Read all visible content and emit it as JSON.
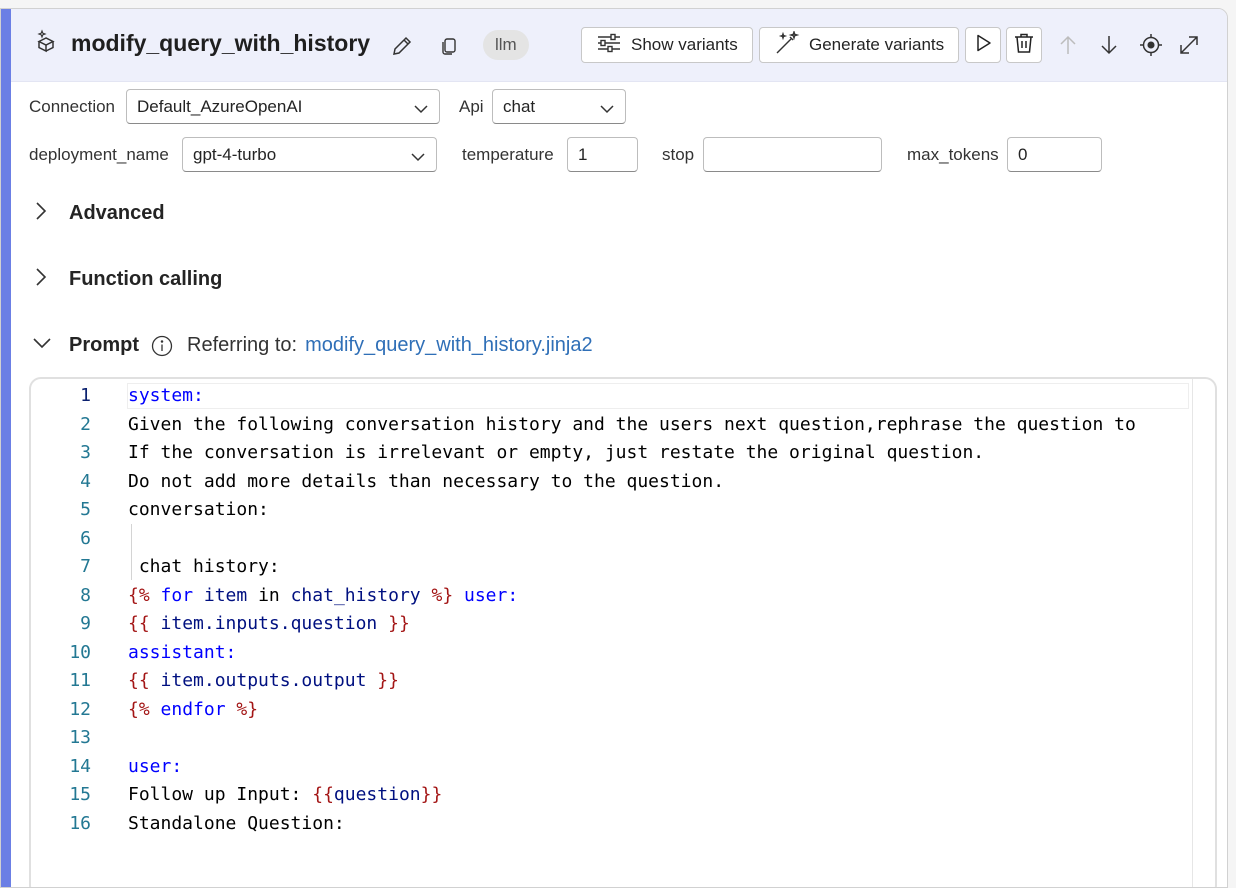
{
  "node": {
    "title": "modify_query_with_history",
    "type_badge": "llm"
  },
  "toolbar": {
    "show_variants_label": "Show variants",
    "generate_variants_label": "Generate variants"
  },
  "settings": {
    "connection_label": "Connection",
    "connection_value": "Default_AzureOpenAI",
    "api_label": "Api",
    "api_value": "chat",
    "deployment_label": "deployment_name",
    "deployment_value": "gpt-4-turbo",
    "temperature_label": "temperature",
    "temperature_value": "1",
    "stop_label": "stop",
    "stop_value": "",
    "max_tokens_label": "max_tokens",
    "max_tokens_value": "0"
  },
  "sections": {
    "advanced": "Advanced",
    "function_calling": "Function calling",
    "prompt": "Prompt",
    "referring_label": "Referring to:",
    "referring_file": "modify_query_with_history.jinja2"
  },
  "editor": {
    "lines": [
      {
        "n": "1",
        "parts": [
          {
            "t": "system:",
            "c": "kw"
          }
        ]
      },
      {
        "n": "2",
        "parts": [
          {
            "t": "Given the following conversation history and the users next question,rephrase the question to",
            "c": "txt"
          }
        ]
      },
      {
        "n": "3",
        "parts": [
          {
            "t": "If the conversation is irrelevant or empty, just restate the original question.",
            "c": "txt"
          }
        ]
      },
      {
        "n": "4",
        "parts": [
          {
            "t": "Do not add more details than necessary to the question.",
            "c": "txt"
          }
        ]
      },
      {
        "n": "5",
        "parts": [
          {
            "t": "conversation:",
            "c": "txt"
          }
        ]
      },
      {
        "n": "6",
        "parts": [
          {
            "t": "",
            "c": "txt"
          }
        ]
      },
      {
        "n": "7",
        "parts": [
          {
            "t": " chat history:",
            "c": "txt"
          }
        ]
      },
      {
        "n": "8",
        "parts": [
          {
            "t": "{%",
            "c": "br"
          },
          {
            "t": " for ",
            "c": "kw"
          },
          {
            "t": "item",
            "c": "var"
          },
          {
            "t": " in ",
            "c": "txt"
          },
          {
            "t": "chat_history",
            "c": "var"
          },
          {
            "t": " %}",
            "c": "br"
          },
          {
            "t": " user:",
            "c": "kw"
          }
        ]
      },
      {
        "n": "9",
        "parts": [
          {
            "t": "{{",
            "c": "br"
          },
          {
            "t": " item.inputs.question ",
            "c": "var"
          },
          {
            "t": "}}",
            "c": "br"
          }
        ]
      },
      {
        "n": "10",
        "parts": [
          {
            "t": "assistant:",
            "c": "kw"
          }
        ]
      },
      {
        "n": "11",
        "parts": [
          {
            "t": "{{",
            "c": "br"
          },
          {
            "t": " item.outputs.output ",
            "c": "var"
          },
          {
            "t": "}}",
            "c": "br"
          }
        ]
      },
      {
        "n": "12",
        "parts": [
          {
            "t": "{%",
            "c": "br"
          },
          {
            "t": " endfor ",
            "c": "kw"
          },
          {
            "t": "%}",
            "c": "br"
          }
        ]
      },
      {
        "n": "13",
        "parts": [
          {
            "t": "",
            "c": "txt"
          }
        ]
      },
      {
        "n": "14",
        "parts": [
          {
            "t": "user:",
            "c": "kw"
          }
        ]
      },
      {
        "n": "15",
        "parts": [
          {
            "t": "Follow up Input: ",
            "c": "txt"
          },
          {
            "t": "{{",
            "c": "br"
          },
          {
            "t": "question",
            "c": "var"
          },
          {
            "t": "}}",
            "c": "br"
          }
        ]
      },
      {
        "n": "16",
        "parts": [
          {
            "t": "Standalone Question:",
            "c": "txt"
          }
        ]
      }
    ]
  },
  "icons": {
    "node": "cube-sparkle-icon",
    "edit": "pencil-icon",
    "copy": "copy-icon",
    "run": "play-icon",
    "delete": "trash-icon",
    "up": "arrow-up-icon",
    "down": "arrow-down-icon",
    "locate": "target-icon",
    "expand": "expand-icon"
  },
  "colors": {
    "accent_bar": "#6b7fe5",
    "header_bg": "#eef0fb",
    "link": "#2f6fb7"
  }
}
